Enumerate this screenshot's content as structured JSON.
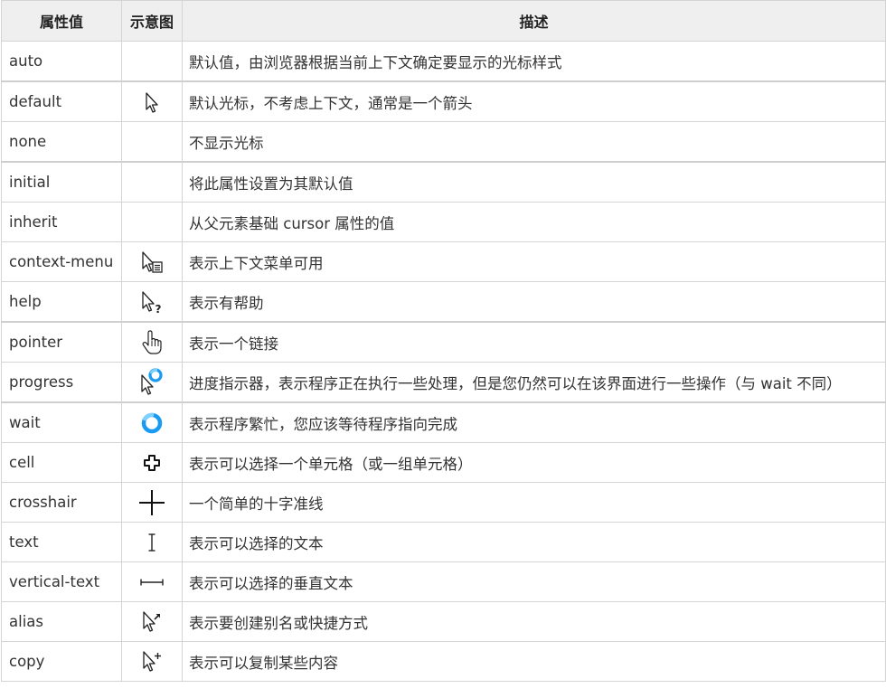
{
  "headers": {
    "value": "属性值",
    "diagram": "示意图",
    "description": "描述"
  },
  "rows": [
    {
      "value": "auto",
      "icon": "none",
      "description": "默认值，由浏览器根据当前上下文确定要显示的光标样式"
    },
    {
      "value": "default",
      "icon": "arrow-cursor-icon",
      "description": "默认光标，不考虑上下文，通常是一个箭头"
    },
    {
      "value": "none",
      "icon": "none",
      "description": "不显示光标"
    },
    {
      "value": "initial",
      "icon": "none",
      "description": "将此属性设置为其默认值"
    },
    {
      "value": "inherit",
      "icon": "none",
      "description": "从父元素基础 cursor 属性的值"
    },
    {
      "value": "context-menu",
      "icon": "context-menu-cursor-icon",
      "description": "表示上下文菜单可用"
    },
    {
      "value": "help",
      "icon": "help-cursor-icon",
      "description": "表示有帮助"
    },
    {
      "value": "pointer",
      "icon": "hand-pointer-cursor-icon",
      "description": "表示一个链接"
    },
    {
      "value": "progress",
      "icon": "progress-cursor-icon",
      "description": "进度指示器，表示程序正在执行一些处理，但是您仍然可以在该界面进行一些操作（与 wait 不同）"
    },
    {
      "value": "wait",
      "icon": "wait-spinner-cursor-icon",
      "description": "表示程序繁忙，您应该等待程序指向完成"
    },
    {
      "value": "cell",
      "icon": "cell-cursor-icon",
      "description": "表示可以选择一个单元格（或一组单元格）"
    },
    {
      "value": "crosshair",
      "icon": "crosshair-cursor-icon",
      "description": "一个简单的十字准线"
    },
    {
      "value": "text",
      "icon": "text-ibeam-cursor-icon",
      "description": "表示可以选择的文本"
    },
    {
      "value": "vertical-text",
      "icon": "vertical-text-cursor-icon",
      "description": "表示可以选择的垂直文本"
    },
    {
      "value": "alias",
      "icon": "alias-cursor-icon",
      "description": "表示要创建别名或快捷方式"
    },
    {
      "value": "copy",
      "icon": "copy-cursor-icon",
      "description": "表示可以复制某些内容"
    }
  ]
}
